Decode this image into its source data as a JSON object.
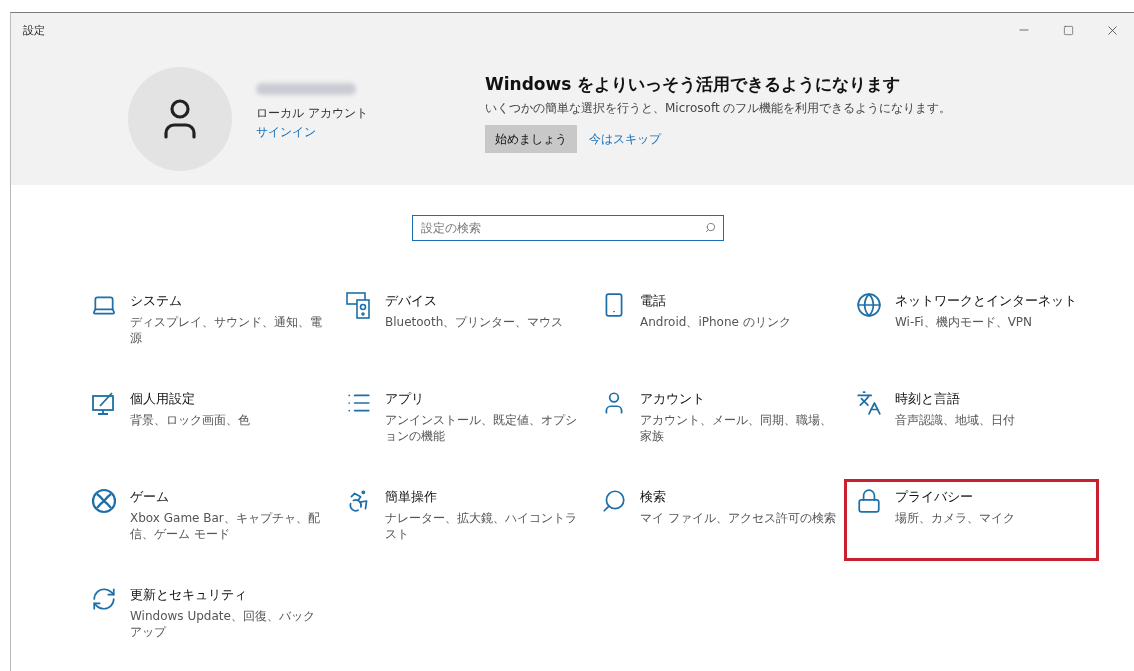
{
  "window": {
    "title": "設定"
  },
  "account": {
    "type": "ローカル アカウント",
    "sign_in": "サインイン"
  },
  "promo": {
    "title": "Windows をよりいっそう活用できるようになります",
    "text": "いくつかの簡単な選択を行うと、Microsoft のフル機能を利用できるようになります。",
    "primary": "始めましょう",
    "secondary": "今はスキップ"
  },
  "search": {
    "placeholder": "設定の検索"
  },
  "tiles": [
    {
      "kind": "system",
      "title": "システム",
      "subtitle": "ディスプレイ、サウンド、通知、電源",
      "highlighted": false
    },
    {
      "kind": "devices",
      "title": "デバイス",
      "subtitle": "Bluetooth、プリンター、マウス",
      "highlighted": false
    },
    {
      "kind": "phone",
      "title": "電話",
      "subtitle": "Android、iPhone のリンク",
      "highlighted": false
    },
    {
      "kind": "network",
      "title": "ネットワークとインターネット",
      "subtitle": "Wi-Fi、機内モード、VPN",
      "highlighted": false
    },
    {
      "kind": "personalization",
      "title": "個人用設定",
      "subtitle": "背景、ロック画面、色",
      "highlighted": false
    },
    {
      "kind": "apps",
      "title": "アプリ",
      "subtitle": "アンインストール、既定値、オプションの機能",
      "highlighted": false
    },
    {
      "kind": "accounts",
      "title": "アカウント",
      "subtitle": "アカウント、メール、同期、職場、家族",
      "highlighted": false
    },
    {
      "kind": "time",
      "title": "時刻と言語",
      "subtitle": "音声認識、地域、日付",
      "highlighted": false
    },
    {
      "kind": "gaming",
      "title": "ゲーム",
      "subtitle": "Xbox Game Bar、キャプチャ、配信、ゲーム モード",
      "highlighted": false
    },
    {
      "kind": "ease",
      "title": "簡単操作",
      "subtitle": "ナレーター、拡大鏡、ハイコントラスト",
      "highlighted": false
    },
    {
      "kind": "search",
      "title": "検索",
      "subtitle": "マイ ファイル、アクセス許可の検索",
      "highlighted": false
    },
    {
      "kind": "privacy",
      "title": "プライバシー",
      "subtitle": "場所、カメラ、マイク",
      "highlighted": true
    },
    {
      "kind": "update",
      "title": "更新とセキュリティ",
      "subtitle": "Windows Update、回復、バックアップ",
      "highlighted": false
    }
  ]
}
